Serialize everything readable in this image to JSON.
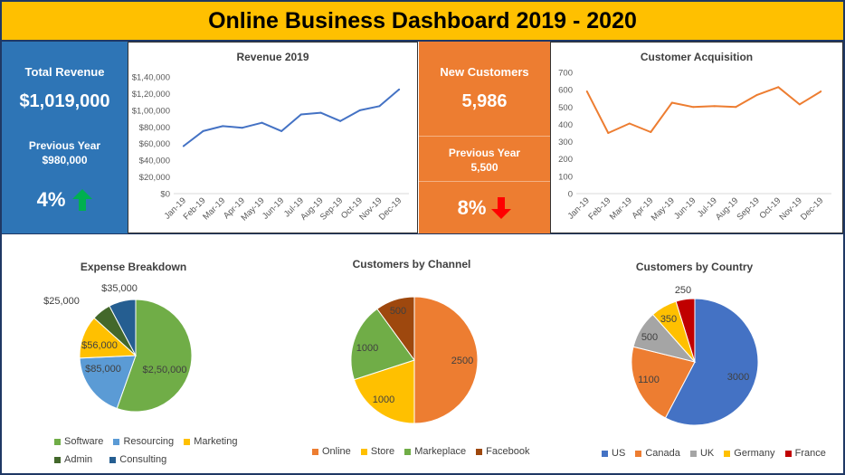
{
  "header": {
    "title": "Online Business Dashboard 2019 - 2020"
  },
  "colors": {
    "header_bg": "#ffc000",
    "blue": "#2e75b6",
    "orange": "#ed7d31",
    "green_arrow": "#00b050",
    "red_arrow": "#ff0000"
  },
  "kpi_revenue": {
    "label": "Total Revenue",
    "value": "$1,019,000",
    "prev_label": "Previous Year",
    "prev_value": "$980,000",
    "change": "4%",
    "trend_icon": "arrow-up-icon"
  },
  "kpi_customers": {
    "label": "New Customers",
    "value": "5,986",
    "prev_label": "Previous Year",
    "prev_value": "5,500",
    "change": "8%",
    "trend_icon": "arrow-down-icon"
  },
  "chart_data": [
    {
      "type": "line",
      "title": "Revenue 2019",
      "categories": [
        "Jan-19",
        "Feb-19",
        "Mar-19",
        "Apr-19",
        "May-19",
        "Jun-19",
        "Jul-19",
        "Aug-19",
        "Sep-19",
        "Oct-19",
        "Nov-19",
        "Dec-19"
      ],
      "values": [
        57000,
        75000,
        81000,
        79000,
        85000,
        75000,
        95000,
        97000,
        87000,
        100000,
        105000,
        125000
      ],
      "ylim": [
        0,
        140000
      ],
      "yticks": [
        0,
        20000,
        40000,
        60000,
        80000,
        100000,
        120000,
        140000
      ],
      "ytick_labels": [
        "$0",
        "$20,000",
        "$40,000",
        "$60,000",
        "$80,000",
        "$1,00,000",
        "$1,20,000",
        "$1,40,000"
      ],
      "color": "#4472c4",
      "grid": false
    },
    {
      "type": "line",
      "title": "Customer Acquisition",
      "categories": [
        "Jan-19",
        "Feb-19",
        "Mar-19",
        "Apr-19",
        "May-19",
        "Jun-19",
        "Jul-19",
        "Aug-19",
        "Sep-19",
        "Oct-19",
        "Nov-19",
        "Dec-19"
      ],
      "values": [
        590,
        350,
        405,
        355,
        525,
        500,
        505,
        500,
        570,
        615,
        515,
        590
      ],
      "ylim": [
        0,
        700
      ],
      "yticks": [
        0,
        100,
        200,
        300,
        400,
        500,
        600,
        700
      ],
      "ytick_labels": [
        "0",
        "100",
        "200",
        "300",
        "400",
        "500",
        "600",
        "700"
      ],
      "color": "#ed7d31",
      "grid": false
    },
    {
      "type": "pie",
      "title": "Expense Breakdown",
      "slices": [
        {
          "name": "Software",
          "value": 250000,
          "label": "$2,50,000",
          "color": "#70ad47"
        },
        {
          "name": "Resourcing",
          "value": 85000,
          "label": "$85,000",
          "color": "#5b9bd5"
        },
        {
          "name": "Marketing",
          "value": 56000,
          "label": "$56,000",
          "color": "#ffc000"
        },
        {
          "name": "Admin",
          "value": 25000,
          "label": "$25,000",
          "color": "#43682b"
        },
        {
          "name": "Consulting",
          "value": 35000,
          "label": "$35,000",
          "color": "#255e91"
        }
      ],
      "legend": "bottom"
    },
    {
      "type": "pie",
      "title": "Customers by Channel",
      "slices": [
        {
          "name": "Online",
          "value": 2500,
          "label": "2500",
          "color": "#ed7d31"
        },
        {
          "name": "Store",
          "value": 1000,
          "label": "1000",
          "color": "#ffc000"
        },
        {
          "name": "Markeplace",
          "value": 1000,
          "label": "1000",
          "color": "#70ad47"
        },
        {
          "name": "Facebook",
          "value": 500,
          "label": "500",
          "color": "#9e480e"
        }
      ],
      "legend": "bottom"
    },
    {
      "type": "pie",
      "title": "Customers by Country",
      "slices": [
        {
          "name": "US",
          "value": 3000,
          "label": "3000",
          "color": "#4472c4"
        },
        {
          "name": "Canada",
          "value": 1100,
          "label": "1100",
          "color": "#ed7d31"
        },
        {
          "name": "UK",
          "value": 500,
          "label": "500",
          "color": "#a5a5a5"
        },
        {
          "name": "Germany",
          "value": 350,
          "label": "350",
          "color": "#ffc000"
        },
        {
          "name": "France",
          "value": 250,
          "label": "250",
          "color": "#c00000"
        }
      ],
      "legend": "bottom"
    }
  ]
}
